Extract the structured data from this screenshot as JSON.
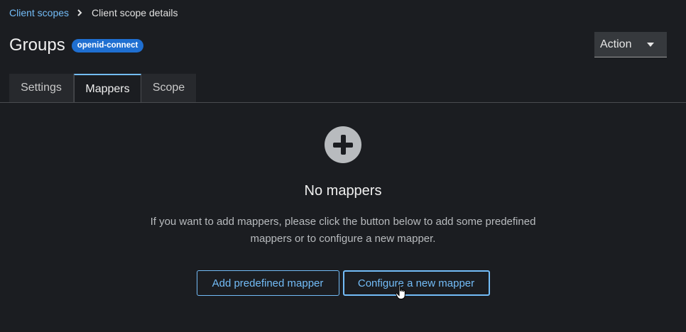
{
  "breadcrumb": {
    "parent": "Client scopes",
    "current": "Client scope details"
  },
  "header": {
    "title": "Groups",
    "protocol_badge": "openid-connect",
    "action_label": "Action"
  },
  "tabs": [
    {
      "label": "Settings",
      "active": false
    },
    {
      "label": "Mappers",
      "active": true
    },
    {
      "label": "Scope",
      "active": false
    }
  ],
  "empty_state": {
    "icon": "plus-circle-icon",
    "title": "No mappers",
    "body": "If you want to add mappers, please click the button below to add some predefined mappers or to configure a new mapper.",
    "primary_action": "Add predefined mapper",
    "secondary_action": "Configure a new mapper"
  },
  "colors": {
    "background": "#1b1d21",
    "link": "#73bcf7",
    "badge": "#1f6fd1"
  }
}
